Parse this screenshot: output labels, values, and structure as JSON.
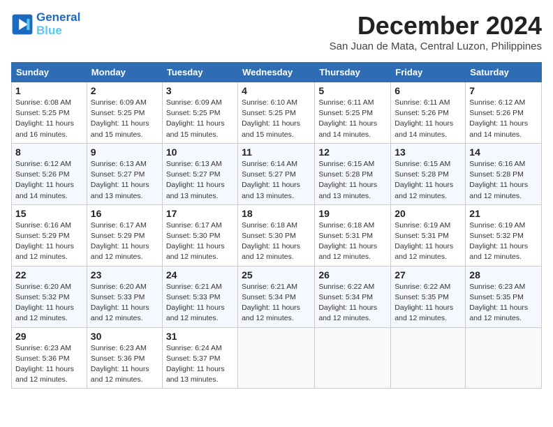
{
  "logo": {
    "line1": "General",
    "line2": "Blue",
    "icon": "▶"
  },
  "title": "December 2024",
  "subtitle": "San Juan de Mata, Central Luzon, Philippines",
  "headers": [
    "Sunday",
    "Monday",
    "Tuesday",
    "Wednesday",
    "Thursday",
    "Friday",
    "Saturday"
  ],
  "weeks": [
    [
      {
        "day": "1",
        "sunrise": "6:08 AM",
        "sunset": "5:25 PM",
        "daylight": "11 hours and 16 minutes."
      },
      {
        "day": "2",
        "sunrise": "6:09 AM",
        "sunset": "5:25 PM",
        "daylight": "11 hours and 15 minutes."
      },
      {
        "day": "3",
        "sunrise": "6:09 AM",
        "sunset": "5:25 PM",
        "daylight": "11 hours and 15 minutes."
      },
      {
        "day": "4",
        "sunrise": "6:10 AM",
        "sunset": "5:25 PM",
        "daylight": "11 hours and 15 minutes."
      },
      {
        "day": "5",
        "sunrise": "6:11 AM",
        "sunset": "5:25 PM",
        "daylight": "11 hours and 14 minutes."
      },
      {
        "day": "6",
        "sunrise": "6:11 AM",
        "sunset": "5:26 PM",
        "daylight": "11 hours and 14 minutes."
      },
      {
        "day": "7",
        "sunrise": "6:12 AM",
        "sunset": "5:26 PM",
        "daylight": "11 hours and 14 minutes."
      }
    ],
    [
      {
        "day": "8",
        "sunrise": "6:12 AM",
        "sunset": "5:26 PM",
        "daylight": "11 hours and 14 minutes."
      },
      {
        "day": "9",
        "sunrise": "6:13 AM",
        "sunset": "5:27 PM",
        "daylight": "11 hours and 13 minutes."
      },
      {
        "day": "10",
        "sunrise": "6:13 AM",
        "sunset": "5:27 PM",
        "daylight": "11 hours and 13 minutes."
      },
      {
        "day": "11",
        "sunrise": "6:14 AM",
        "sunset": "5:27 PM",
        "daylight": "11 hours and 13 minutes."
      },
      {
        "day": "12",
        "sunrise": "6:15 AM",
        "sunset": "5:28 PM",
        "daylight": "11 hours and 13 minutes."
      },
      {
        "day": "13",
        "sunrise": "6:15 AM",
        "sunset": "5:28 PM",
        "daylight": "11 hours and 12 minutes."
      },
      {
        "day": "14",
        "sunrise": "6:16 AM",
        "sunset": "5:28 PM",
        "daylight": "11 hours and 12 minutes."
      }
    ],
    [
      {
        "day": "15",
        "sunrise": "6:16 AM",
        "sunset": "5:29 PM",
        "daylight": "11 hours and 12 minutes."
      },
      {
        "day": "16",
        "sunrise": "6:17 AM",
        "sunset": "5:29 PM",
        "daylight": "11 hours and 12 minutes."
      },
      {
        "day": "17",
        "sunrise": "6:17 AM",
        "sunset": "5:30 PM",
        "daylight": "11 hours and 12 minutes."
      },
      {
        "day": "18",
        "sunrise": "6:18 AM",
        "sunset": "5:30 PM",
        "daylight": "11 hours and 12 minutes."
      },
      {
        "day": "19",
        "sunrise": "6:18 AM",
        "sunset": "5:31 PM",
        "daylight": "11 hours and 12 minutes."
      },
      {
        "day": "20",
        "sunrise": "6:19 AM",
        "sunset": "5:31 PM",
        "daylight": "11 hours and 12 minutes."
      },
      {
        "day": "21",
        "sunrise": "6:19 AM",
        "sunset": "5:32 PM",
        "daylight": "11 hours and 12 minutes."
      }
    ],
    [
      {
        "day": "22",
        "sunrise": "6:20 AM",
        "sunset": "5:32 PM",
        "daylight": "11 hours and 12 minutes."
      },
      {
        "day": "23",
        "sunrise": "6:20 AM",
        "sunset": "5:33 PM",
        "daylight": "11 hours and 12 minutes."
      },
      {
        "day": "24",
        "sunrise": "6:21 AM",
        "sunset": "5:33 PM",
        "daylight": "11 hours and 12 minutes."
      },
      {
        "day": "25",
        "sunrise": "6:21 AM",
        "sunset": "5:34 PM",
        "daylight": "11 hours and 12 minutes."
      },
      {
        "day": "26",
        "sunrise": "6:22 AM",
        "sunset": "5:34 PM",
        "daylight": "11 hours and 12 minutes."
      },
      {
        "day": "27",
        "sunrise": "6:22 AM",
        "sunset": "5:35 PM",
        "daylight": "11 hours and 12 minutes."
      },
      {
        "day": "28",
        "sunrise": "6:23 AM",
        "sunset": "5:35 PM",
        "daylight": "11 hours and 12 minutes."
      }
    ],
    [
      {
        "day": "29",
        "sunrise": "6:23 AM",
        "sunset": "5:36 PM",
        "daylight": "11 hours and 12 minutes."
      },
      {
        "day": "30",
        "sunrise": "6:23 AM",
        "sunset": "5:36 PM",
        "daylight": "11 hours and 12 minutes."
      },
      {
        "day": "31",
        "sunrise": "6:24 AM",
        "sunset": "5:37 PM",
        "daylight": "11 hours and 13 minutes."
      },
      null,
      null,
      null,
      null
    ]
  ],
  "labels": {
    "sunrise": "Sunrise: ",
    "sunset": "Sunset: ",
    "daylight": "Daylight: "
  }
}
